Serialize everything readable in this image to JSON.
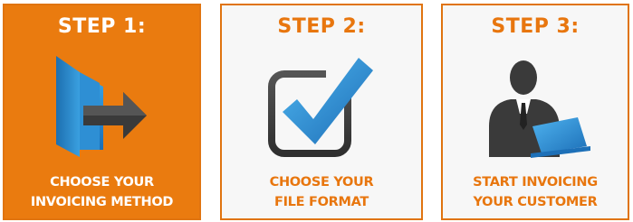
{
  "steps": [
    {
      "title": "STEP 1:",
      "caption_line1": "CHOOSE YOUR",
      "caption_line2": "INVOICING METHOD",
      "icon": "door-exit-arrow-icon",
      "active": true
    },
    {
      "title": "STEP 2:",
      "caption_line1": "CHOOSE YOUR",
      "caption_line2": "FILE FORMAT",
      "icon": "checkbox-check-icon",
      "active": false
    },
    {
      "title": "STEP 3:",
      "caption_line1": "START INVOICING",
      "caption_line2": "YOUR CUSTOMER",
      "icon": "person-laptop-icon",
      "active": false
    }
  ],
  "colors": {
    "accent_orange": "#ea7b0f",
    "text_orange": "#e8760e",
    "panel_gray": "#f7f7f7",
    "icon_blue": "#2b8fd6",
    "icon_dark": "#3a3a3a"
  }
}
